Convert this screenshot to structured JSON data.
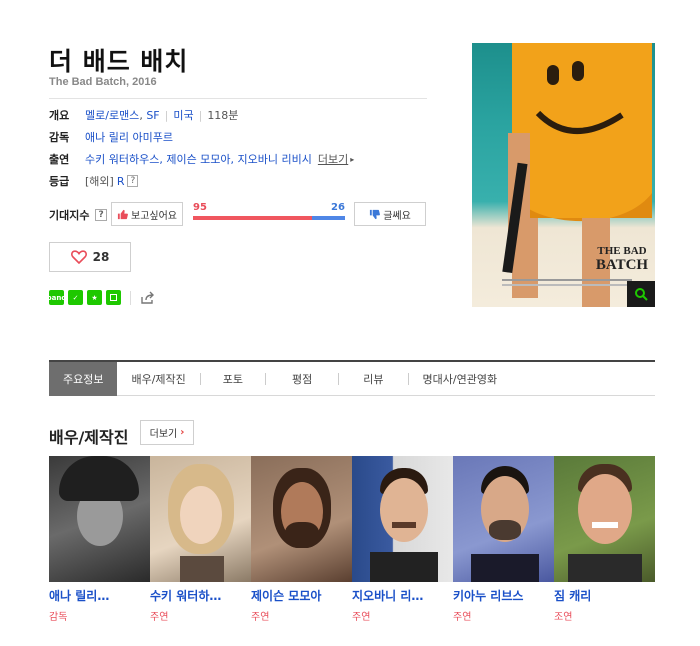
{
  "movie": {
    "title": "더 배드 배치",
    "subtitle": "The Bad Batch, 2016"
  },
  "info": {
    "overview_label": "개요",
    "genres": [
      "멜로/로맨스",
      "SF"
    ],
    "country": "미국",
    "runtime": "118분",
    "director_label": "감독",
    "director": "애나 릴리 아미푸르",
    "cast_label": "출연",
    "cast_text": "수키 워터하우스, 제이슨 모모아, 지오바니 리비시",
    "cast_more": "더보기",
    "rating_label": "등급",
    "rating_region": "[해외]",
    "rating_value": "R"
  },
  "expectation": {
    "label": "기대지수",
    "want_label": "보고싶어요",
    "nah_label": "글쎄요",
    "want_count": "95",
    "nah_count": "26",
    "want_ratio": 0.785
  },
  "like": {
    "count": "28"
  },
  "share": [
    "band",
    "line",
    "star",
    "square"
  ],
  "poster": {
    "title_line1": "THE BAD",
    "title_line2": "BATCH"
  },
  "tabs": [
    "주요정보",
    "배우/제작진",
    "포토",
    "평점",
    "리뷰",
    "명대사/연관영화"
  ],
  "cast_section": {
    "title": "배우/제작진",
    "more_label": "더보기",
    "people": [
      {
        "name": "애나 릴리…",
        "role": "감독"
      },
      {
        "name": "수키 워터하…",
        "role": "주연"
      },
      {
        "name": "제이슨 모모아",
        "role": "주연"
      },
      {
        "name": "지오바니 리…",
        "role": "주연"
      },
      {
        "name": "키아누 리브스",
        "role": "주연"
      },
      {
        "name": "짐 캐리",
        "role": "조연"
      }
    ]
  },
  "colors": {
    "link": "#1a50c8",
    "red": "#e94d5a",
    "blue": "#3b78d8"
  }
}
